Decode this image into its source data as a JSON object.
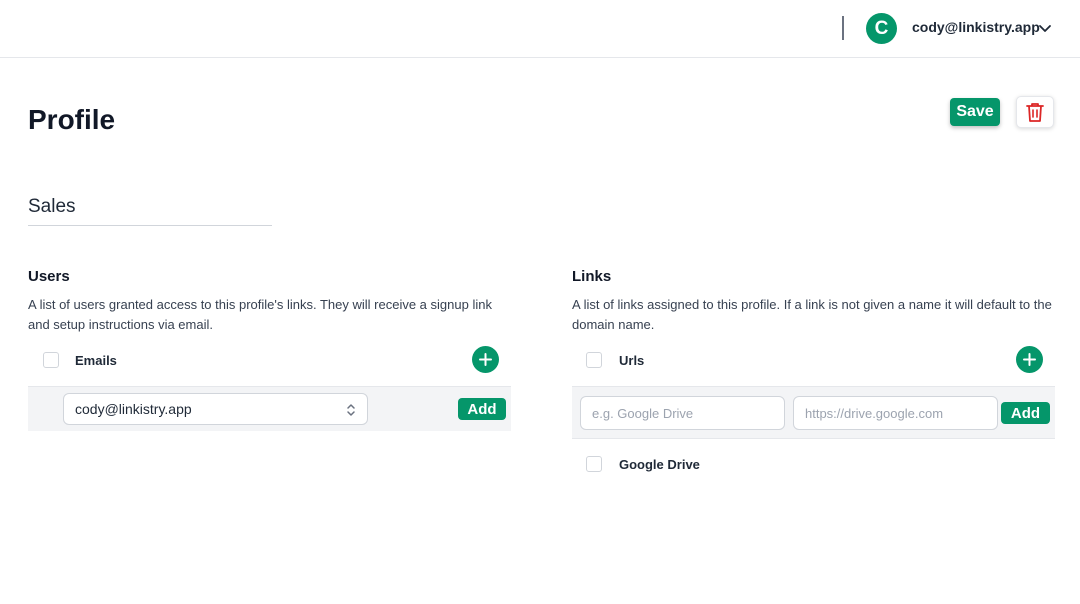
{
  "header": {
    "avatar_initial": "C",
    "user_email": "cody@linkistry.app"
  },
  "page": {
    "title": "Profile",
    "save_label": "Save",
    "profile_name": "Sales"
  },
  "users": {
    "title": "Users",
    "description": "A list of users granted access to this profile's links. They will receive a signup link and setup instructions via email.",
    "column_label": "Emails",
    "selected_email": "cody@linkistry.app",
    "add_label": "Add"
  },
  "links": {
    "title": "Links",
    "description": "A list of links assigned to this profile. If a link is not given a name it will default to the domain name.",
    "column_label": "Urls",
    "name_placeholder": "e.g. Google Drive",
    "url_placeholder": "https://drive.google.com",
    "add_label": "Add",
    "items": [
      {
        "name": "Google Drive"
      }
    ]
  },
  "colors": {
    "accent": "#05966a",
    "delete": "#dc2626"
  },
  "icons": {
    "chevron": "chevron-down-icon",
    "trash": "trash-icon",
    "plus": "plus-icon",
    "select": "select-arrows-icon"
  }
}
